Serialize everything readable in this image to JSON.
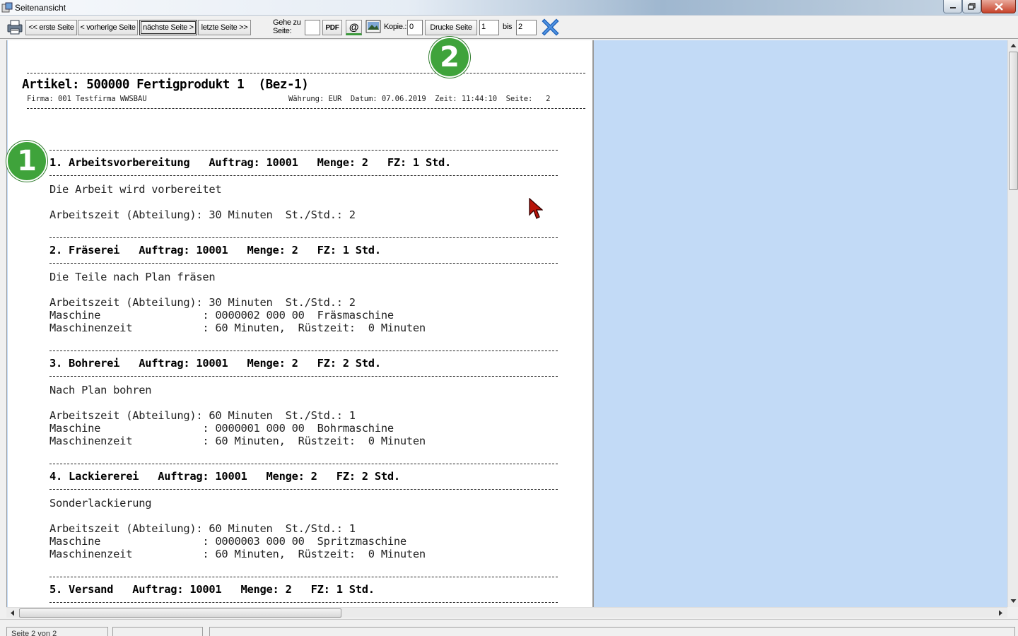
{
  "window": {
    "title": "Seitenansicht"
  },
  "toolbar": {
    "first_page": "<< erste Seite",
    "prev_page": "< vorherige Seite",
    "next_page": "nächste Seite >",
    "last_page": "letzte Seite >>",
    "goto_label": "Gehe zu Seite:",
    "goto_value": "",
    "pdf_label": "PDF",
    "email_label": "@",
    "copies_label": "Kopie.:",
    "copies_value": "0",
    "print_page_label": "Drucke Seite",
    "print_from_value": "1",
    "to_label": "bis",
    "print_to_value": "2"
  },
  "report": {
    "title": "Artikel: 500000 Fertigprodukt 1  (Bez-1)",
    "firma": "Firma: 001 Testfirma WWSBAU",
    "meta": "Währung: EUR  Datum: 07.06.2019  Zeit: 11:44:10  Seite:   2",
    "steps": [
      {
        "heading": "1. Arbeitsvorbereitung   Auftrag: 10001   Menge: 2   FZ: 1 Std.",
        "description": "Die Arbeit wird vorbereitet",
        "worktime": "Arbeitszeit (Abteilung): 30 Minuten  St./Std.: 2",
        "machine": "",
        "machinetime": ""
      },
      {
        "heading": "2. Fräserei   Auftrag: 10001   Menge: 2   FZ: 1 Std.",
        "description": "Die Teile nach Plan fräsen",
        "worktime": "Arbeitszeit (Abteilung): 30 Minuten  St./Std.: 2",
        "machine": "Maschine                : 0000002 000 00  Fräsmaschine",
        "machinetime": "Maschinenzeit           : 60 Minuten,  Rüstzeit:  0 Minuten"
      },
      {
        "heading": "3. Bohrerei   Auftrag: 10001   Menge: 2   FZ: 2 Std.",
        "description": "Nach Plan bohren",
        "worktime": "Arbeitszeit (Abteilung): 60 Minuten  St./Std.: 1",
        "machine": "Maschine                : 0000001 000 00  Bohrmaschine",
        "machinetime": "Maschinenzeit           : 60 Minuten,  Rüstzeit:  0 Minuten"
      },
      {
        "heading": "4. Lackiererei   Auftrag: 10001   Menge: 2   FZ: 2 Std.",
        "description": "Sonderlackierung",
        "worktime": "Arbeitszeit (Abteilung): 60 Minuten  St./Std.: 1",
        "machine": "Maschine                : 0000003 000 00  Spritzmaschine",
        "machinetime": "Maschinenzeit           : 60 Minuten,  Rüstzeit:  0 Minuten"
      },
      {
        "heading": "5. Versand   Auftrag: 10001   Menge: 2   FZ: 1 Std."
      }
    ]
  },
  "statusbar": {
    "page_info": "Seite  2    von  2"
  },
  "badges": {
    "one": "1",
    "two": "2"
  },
  "colors": {
    "page_bg": "#ffffff",
    "viewport_bg": "#c2daf6",
    "badge": "#3fa33b",
    "close_icon": "#2a6fd0"
  }
}
